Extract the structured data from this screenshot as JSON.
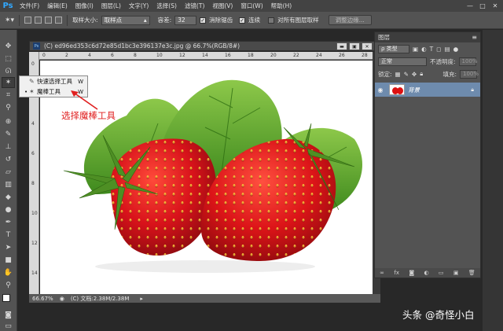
{
  "app": {
    "logo": "Ps"
  },
  "menu": [
    "文件(F)",
    "编辑(E)",
    "图像(I)",
    "图层(L)",
    "文字(Y)",
    "选择(S)",
    "滤镜(T)",
    "视图(V)",
    "窗口(W)",
    "帮助(H)"
  ],
  "window_controls": {
    "minimize": "—",
    "maximize": "□",
    "close": "✕"
  },
  "options": {
    "sample_size_label": "取样大小:",
    "sample_size_value": "取样点",
    "tolerance_label": "容差:",
    "tolerance_value": "32",
    "antialias_label": "消除锯齿",
    "antialias_checked": true,
    "contiguous_label": "连续",
    "contiguous_checked": true,
    "all_layers_label": "对所有图层取样",
    "all_layers_checked": false,
    "refine_edge_label": "调整边缘..."
  },
  "tool_flyout": {
    "items": [
      {
        "label": "快速选择工具",
        "key": "W",
        "selected": false
      },
      {
        "label": "魔棒工具",
        "key": "W",
        "selected": true
      }
    ]
  },
  "annotation": {
    "text": "选择魔棒工具",
    "color": "#e02020"
  },
  "document": {
    "title": "(C) ed96ed353c6d72e85d1bc3e396137e3c.jpg @ 66.7%(RGB/8#)",
    "zoom": "66.67%",
    "status": "(C) 文档:2.38M/2.38M",
    "ruler_top": [
      "0",
      "2",
      "4",
      "6",
      "8",
      "10",
      "12",
      "14",
      "16",
      "18",
      "20",
      "22",
      "24",
      "26",
      "28"
    ],
    "ruler_left": [
      "0",
      "2",
      "4",
      "6",
      "8",
      "10",
      "12",
      "14"
    ]
  },
  "layers_panel": {
    "title": "图层",
    "filter_kind": "ρ 类型",
    "blend_mode": "正常",
    "opacity_label": "不透明度:",
    "opacity_value": "100%",
    "lock_label": "锁定:",
    "fill_label": "填充:",
    "fill_value": "100%",
    "layer_name": "背景"
  },
  "watermark": "头条 @奇怪小白",
  "colors": {
    "accent": "#31a8ff",
    "selected_layer": "#6e8bad",
    "panel": "#535353",
    "annotation": "#e02020"
  }
}
